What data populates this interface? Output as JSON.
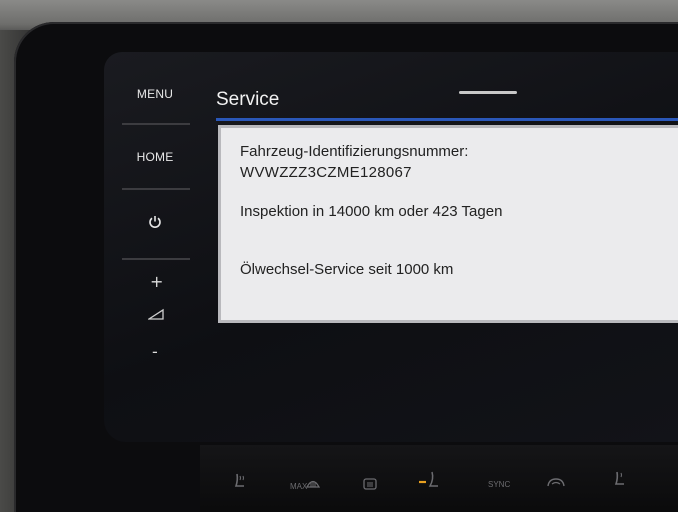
{
  "sidebar": {
    "menu_label": "MENU",
    "home_label": "HOME",
    "power_icon": "power-icon",
    "volume_up": "+",
    "volume_icon": "volume-icon",
    "volume_down": "-"
  },
  "screen": {
    "title": "Service",
    "accent_color": "#2a57b8"
  },
  "info": {
    "vin_label": "Fahrzeug-Identifizierungsnummer:",
    "vin_value": "WVWZZZ3CZME128067",
    "inspection": "Inspektion in 14000 km oder 423 Tagen",
    "oil_service": "Ölwechsel-Service seit 1000 km"
  },
  "climate": {
    "max_label": "MAX",
    "sync_label": "SYNC",
    "icons": [
      "seat-heat-left-icon",
      "max-defrost-icon",
      "rear-defrost-icon",
      "seat-vent-icon",
      "sync-label",
      "recirculation-icon",
      "seat-heat-right-icon"
    ]
  }
}
